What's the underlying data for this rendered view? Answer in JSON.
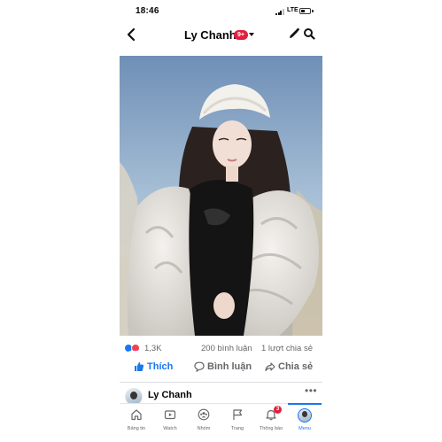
{
  "status_bar": {
    "time": "18:46",
    "network": "LTE"
  },
  "header": {
    "title": "Ly Chanh",
    "badge": "9+",
    "icons": [
      "back-icon",
      "edit-icon",
      "search-icon",
      "chevron-down-icon"
    ]
  },
  "post": {
    "reactions": {
      "count": "1,3K",
      "types": [
        "like",
        "love"
      ]
    },
    "comments": "200 bình luận",
    "shares": "1 lượt chia sẻ",
    "actions": {
      "like": "Thích",
      "comment": "Bình luận",
      "share": "Chia sẻ"
    }
  },
  "next_post": {
    "author": "Ly Chanh",
    "more": "•••"
  },
  "tabbar": {
    "tabs": [
      {
        "label": "Bảng tin",
        "icon": "home-icon"
      },
      {
        "label": "Watch",
        "icon": "video-icon"
      },
      {
        "label": "Nhóm",
        "icon": "groups-icon"
      },
      {
        "label": "Trang",
        "icon": "flag-icon"
      },
      {
        "label": "Thông báo",
        "icon": "bell-icon",
        "badge": "3"
      },
      {
        "label": "Menu",
        "icon": "avatar",
        "active": true
      }
    ]
  },
  "colors": {
    "accent": "#1877f2",
    "badge": "#e41e3f",
    "muted": "#65676b"
  }
}
